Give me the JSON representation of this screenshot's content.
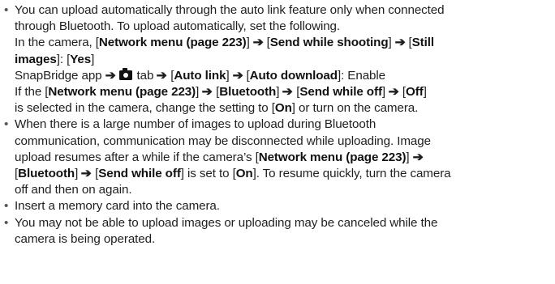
{
  "sep_arrow": "➔",
  "bullet_char": "•",
  "items": [
    {
      "lines": [
        [
          "You can upload automatically through the auto link feature only when connected"
        ],
        [
          "through Bluetooth. To upload automatically, set the following."
        ],
        [
          "In the camera, [",
          "Network menu (page 223)",
          "] ",
          "ARROW",
          " [",
          "Send while shooting",
          "] ",
          "ARROW",
          " [",
          "Still"
        ],
        [
          "images",
          "]: [",
          "Yes",
          "]"
        ],
        [
          "SnapBridge app ",
          "ARROW",
          " ",
          "CAMERA_ICON",
          " tab ",
          "ARROW",
          " [",
          "Auto link",
          "] ",
          "ARROW",
          " [",
          "Auto download",
          "]: Enable"
        ],
        [
          "If the [",
          "Network menu (page 223)",
          "] ",
          "ARROW",
          " [",
          "Bluetooth",
          "] ",
          "ARROW",
          " [",
          "Send while off",
          "] ",
          "ARROW",
          " [",
          "Off",
          "]"
        ],
        [
          "is selected in the camera, change the setting to [",
          "On",
          "] or turn on the camera."
        ]
      ]
    },
    {
      "lines": [
        [
          "When there is a large number of images to upload during Bluetooth"
        ],
        [
          "communication, communication may be disconnected while uploading. Image"
        ],
        [
          "upload resumes after a while if the camera’s [",
          "Network menu (page 223)",
          "] ",
          "ARROW"
        ],
        [
          "[",
          "Bluetooth",
          "] ",
          "ARROW",
          " [",
          "Send while off",
          "] is set to [",
          "On",
          "]. To resume quickly, turn the camera"
        ],
        [
          "off and then on again."
        ]
      ]
    },
    {
      "lines": [
        [
          "Insert a memory card into the camera."
        ]
      ]
    },
    {
      "lines": [
        [
          "You may not be able to upload images or uploading may be canceled while the"
        ],
        [
          "camera is being operated."
        ]
      ]
    }
  ],
  "bold_markers": [
    "Network menu (page 223)",
    "Send while shooting",
    "Still",
    "images",
    "Yes",
    "Auto link",
    "Auto download",
    "Bluetooth",
    "Send while off",
    "Off",
    "On"
  ],
  "icons": {
    "camera_tab_icon": "camera-icon"
  }
}
